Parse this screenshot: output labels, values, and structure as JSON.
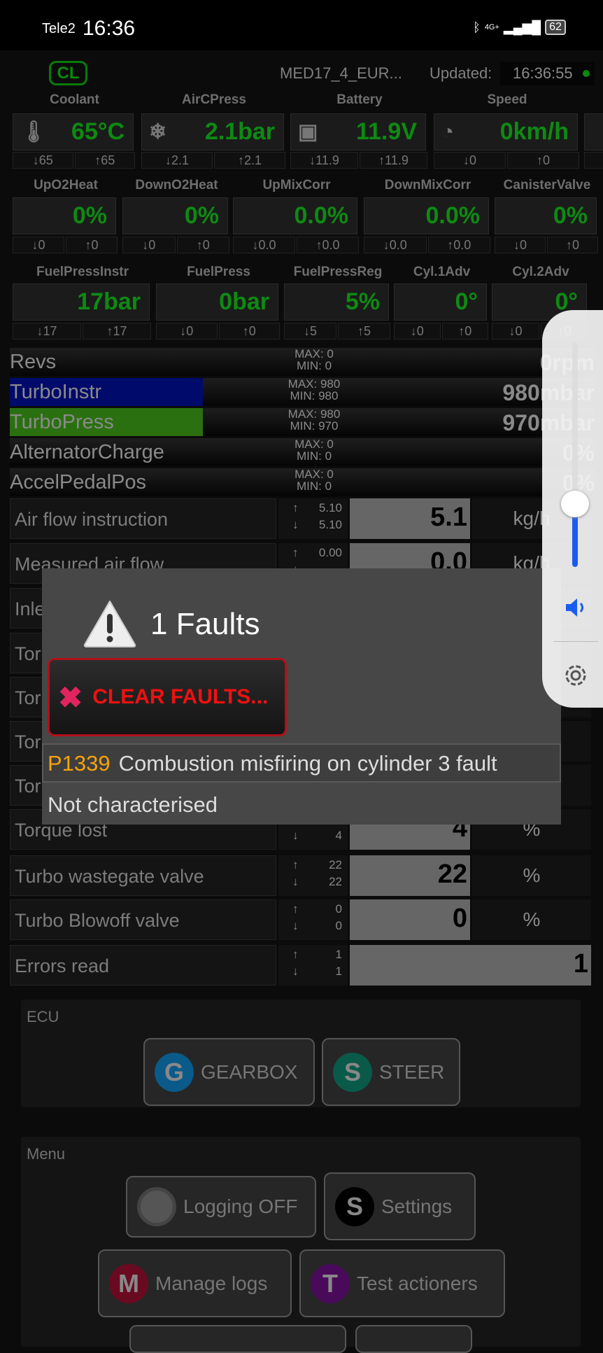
{
  "status_bar": {
    "carrier": "Tele2",
    "time": "16:36",
    "network": "4G+",
    "battery": "62"
  },
  "header": {
    "badge": "CL",
    "ecu": "MED17_4_EUR...",
    "updated_label": "Updated:",
    "updated_time": "16:36:55"
  },
  "gauge_rows": [
    [
      {
        "label": "Coolant",
        "value": "65°C",
        "icon": "thermometer-icon",
        "min": "↓65",
        "max": "↑65"
      },
      {
        "label": "AirCPress",
        "value": "2.1bar",
        "icon": "snowflake-icon",
        "min": "↓2.1",
        "max": "↑2.1"
      },
      {
        "label": "Battery",
        "value": "11.9V",
        "icon": "battery-icon",
        "min": "↓11.9",
        "max": "↑11.9"
      },
      {
        "label": "Speed",
        "value": "0km/h",
        "icon": "speedometer-icon",
        "min": "↓0",
        "max": "↑0"
      }
    ],
    [
      {
        "label": "UpO2Heat",
        "value": "0%",
        "min": "↓0",
        "max": "↑0"
      },
      {
        "label": "DownO2Heat",
        "value": "0%",
        "min": "↓0",
        "max": "↑0"
      },
      {
        "label": "UpMixCorr",
        "value": "0.0%",
        "min": "↓0.0",
        "max": "↑0.0"
      },
      {
        "label": "DownMixCorr",
        "value": "0.0%",
        "min": "↓0.0",
        "max": "↑0.0"
      },
      {
        "label": "CanisterValve",
        "value": "0%",
        "min": "↓0",
        "max": "↑0"
      }
    ],
    [
      {
        "label": "FuelPressInstr",
        "value": "17bar",
        "min": "↓17",
        "max": "↑17"
      },
      {
        "label": "FuelPress",
        "value": "0bar",
        "min": "↓0",
        "max": "↑0"
      },
      {
        "label": "FuelPressReg",
        "value": "5%",
        "min": "↓5",
        "max": "↑5"
      },
      {
        "label": "Cyl.1Adv",
        "value": "0°",
        "min": "↓0",
        "max": "↑0"
      },
      {
        "label": "Cyl.2Adv",
        "value": "0°",
        "min": "↓0",
        "max": "↑0"
      }
    ]
  ],
  "bars": [
    {
      "name": "Revs",
      "max": "MAX: 0",
      "min": "MIN: 0",
      "value": "0rpm",
      "fill": 0,
      "color": ""
    },
    {
      "name": "TurboInstr",
      "max": "MAX: 980",
      "min": "MIN: 980",
      "value": "980mbar",
      "fill": 0.33,
      "color": "#000a6a"
    },
    {
      "name": "TurboPress",
      "max": "MAX: 980",
      "min": "MIN: 970",
      "value": "970mbar",
      "fill": 0.33,
      "color": "#2a7010"
    },
    {
      "name": "AlternatorCharge",
      "max": "MAX: 0",
      "min": "MIN: 0",
      "value": "0%",
      "fill": 0,
      "color": ""
    },
    {
      "name": "AccelPedalPos",
      "max": "MAX: 0",
      "min": "MIN: 0",
      "value": "0%",
      "fill": 0,
      "color": ""
    }
  ],
  "table": [
    {
      "name": "Air flow instruction",
      "up": "5.10",
      "down": "5.10",
      "value": "5.1",
      "unit": "kg/h"
    },
    {
      "name": "Measured air flow",
      "up": "0.00",
      "down": "",
      "value": "0.0",
      "unit": "kg/h"
    },
    {
      "name": "Inle",
      "up": "",
      "down": "",
      "value": "",
      "unit": ""
    },
    {
      "name": "Tor",
      "up": "",
      "down": "",
      "value": "",
      "unit": ""
    },
    {
      "name": "Tor",
      "up": "",
      "down": "",
      "value": "",
      "unit": ""
    },
    {
      "name": "Tor",
      "up": "",
      "down": "",
      "value": "",
      "unit": ""
    },
    {
      "name": "Tor",
      "up": "",
      "down": "",
      "value": "",
      "unit": ""
    },
    {
      "name": "Torque lost",
      "up": "",
      "down": "4",
      "value": "4",
      "unit": "%"
    },
    {
      "name": "Turbo wastegate valve",
      "up": "22",
      "down": "22",
      "value": "22",
      "unit": "%"
    },
    {
      "name": "Turbo Blowoff valve",
      "up": "0",
      "down": "0",
      "value": "0",
      "unit": "%"
    },
    {
      "name": "Errors read",
      "up": "1",
      "down": "1",
      "value": "1",
      "unit": ""
    }
  ],
  "dialog": {
    "title": "1 Faults",
    "clear_label": "CLEAR FAULTS...",
    "fault_code": "P1339",
    "fault_text": "Combustion misfiring on cylinder 3 fault",
    "fault_status": "Not characterised"
  },
  "volume": {
    "level": 0.28,
    "accent": "#1a5cf0"
  },
  "ecu_panel": {
    "label": "ECU",
    "buttons": [
      {
        "letter": "G",
        "label": "GEARBOX",
        "color": "#0a5a8a"
      },
      {
        "letter": "S",
        "label": "STEER",
        "color": "#0a5a4a"
      }
    ]
  },
  "menu_panel": {
    "label": "Menu",
    "buttons": [
      {
        "letter": "",
        "label": "Logging OFF",
        "color": "#555"
      },
      {
        "letter": "S",
        "label": "Settings",
        "color": "#000"
      },
      {
        "letter": "M",
        "label": "Manage logs",
        "color": "#6a0a20"
      },
      {
        "letter": "T",
        "label": "Test actioners",
        "color": "#4a0a5a"
      }
    ]
  }
}
